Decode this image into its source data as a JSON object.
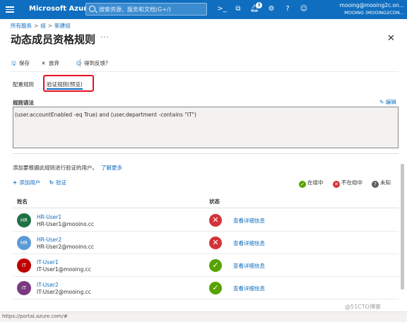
{
  "topbar": {
    "brand": "Microsoft Azure",
    "search_placeholder": "搜索资源、服务和文档(G+/)",
    "notification_count": "3",
    "account_email": "mooing@mooing2c.on...",
    "account_tenant": "MOOING (MOOING2CON..."
  },
  "breadcrumb": {
    "item1": "所有服务",
    "item2": "组",
    "item3": "新建组"
  },
  "page": {
    "title": "动态成员资格规则",
    "more": "···"
  },
  "toolbar": {
    "save": "保存",
    "discard": "放弃",
    "feedback": "得到反馈?"
  },
  "tabs": {
    "configure": "配置规则",
    "validate": "验证规则(预览)"
  },
  "rule": {
    "label": "规则语法",
    "edit": "编辑",
    "text": "(user.accountEnabled -eq True) and (user.department -contains \"IT\")"
  },
  "validate": {
    "description": "添加要根据此规则进行验证的用户。",
    "learn_more": "了解更多",
    "add_users": "添加用户",
    "validate_btn": "验证",
    "legend_in": "在组中",
    "legend_out": "不在组中",
    "legend_unknown": "未知"
  },
  "table": {
    "col_name": "姓名",
    "col_status": "状态",
    "detail_label": "查看详细信息",
    "rows": [
      {
        "initials": "HR",
        "name": "HR-User1",
        "email": "HR-User1@mooino.cc",
        "status": "out",
        "color": "#1e7145"
      },
      {
        "initials": "HR",
        "name": "HR-User2",
        "email": "HR-User2@mooino.cc",
        "status": "out",
        "color": "#5b9bd5"
      },
      {
        "initials": "IT",
        "name": "IT-User1",
        "email": "IT-User1@mooing.cc",
        "status": "in",
        "color": "#c00000"
      },
      {
        "initials": "IT",
        "name": "IT-User2",
        "email": "IT-User2@mooing.cc",
        "status": "in",
        "color": "#7b3a7f"
      }
    ]
  },
  "statusbar": {
    "url": "https://portal.azure.com/#",
    "watermark": "@51CTO博客"
  },
  "colors": {
    "in": "#57a300",
    "out": "#d13438",
    "unknown": "#605e5c",
    "accent": "#0f6cbd"
  }
}
